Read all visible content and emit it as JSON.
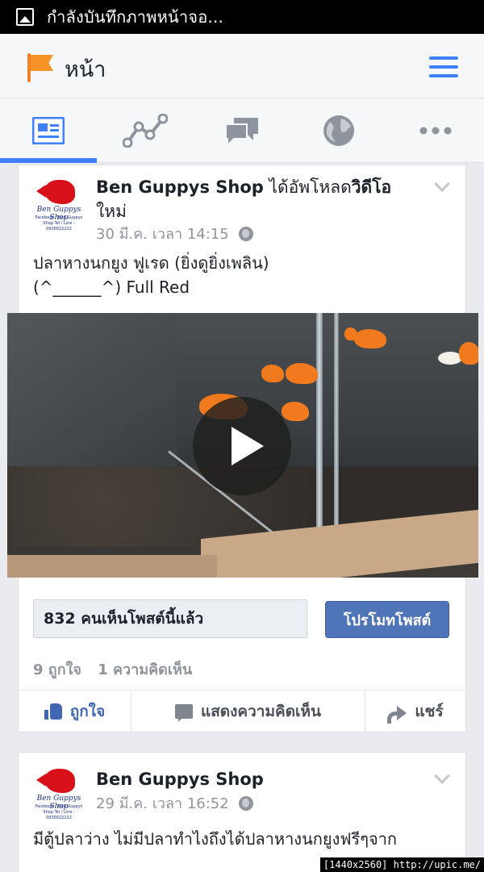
{
  "status_bar": {
    "text": "กำลังบันทึกภาพหน้าจอ..."
  },
  "header": {
    "title": "หน้า"
  },
  "tabs": [
    "news-feed",
    "insights",
    "messages",
    "notifications",
    "more"
  ],
  "posts": [
    {
      "page_name": "Ben Guppys Shop",
      "action_text": " ได้อัพโหลด",
      "action_bold": "วิดีโอ",
      "action_text2": "ใหม่",
      "timestamp": "30 มี.ค. เวลา 14:15",
      "text_line1": "ปลาหางนกยูง ฟูเรด (ยิ่งดูยิ่งเพลิน)",
      "text_line2": "(^______^) Full Red",
      "reach": "832 คนเห็นโพสต์นี้แล้ว",
      "promote_label": "โปรโมทโพสต์",
      "likes": "9 ถูกใจ",
      "comments": "1 ความคิดเห็น",
      "like_label": "ถูกใจ",
      "comment_label": "แสดงความคิดเห็น",
      "share_label": "แชร์"
    },
    {
      "page_name": "Ben Guppys Shop",
      "timestamp": "29 มี.ค. เวลา 16:52",
      "text_line1": "มีตู้ปลาว่าง  ไม่มีปลาทำไงถึงได้ปลาหางนกยูงฟรีๆจาก"
    }
  ],
  "avatar": {
    "brand": "Ben Guppys Shop",
    "small_text": "Facebook : Ben Guppys Shop Tel / Line : 0935622222"
  },
  "watermark": "[1440x2560] http://upic.me/",
  "colors": {
    "accent": "#4080ff",
    "link": "#4267b2",
    "promote": "#4f74b8"
  }
}
